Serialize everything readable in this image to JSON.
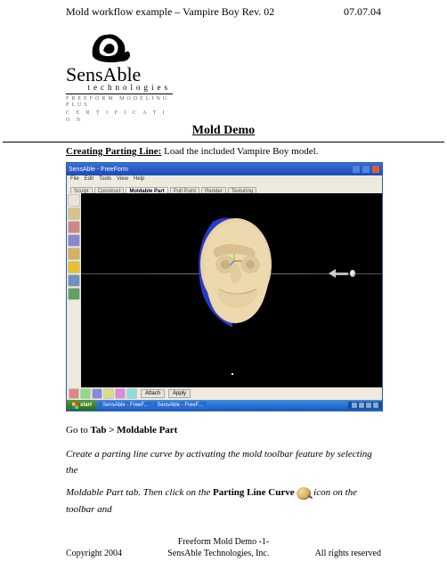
{
  "header": {
    "doc_title": "Mold workflow example – Vampire Boy Rev. 02",
    "date": "07.07.04"
  },
  "logo": {
    "name_main": "SensAble",
    "name_sub": "technologies",
    "cert_line1": "FREEFORM   MODELING   PLUS",
    "cert_line2": "C  E  R  T  I  F  I  C  A  T  I  O  N"
  },
  "title": "Mold Demo",
  "section": {
    "heading": "Creating Parting Line:",
    "heading_rest": "  Load the included Vampire Boy model."
  },
  "app_window": {
    "title": "SensAble - FreeForm",
    "menu": [
      "File",
      "Edit",
      "Tools",
      "View",
      "Help"
    ],
    "tabs": {
      "items": [
        "Sculpt",
        "Construct",
        "Moldable Part",
        "Pull Point",
        "Render",
        "Texturing"
      ],
      "active": "Moldable Part"
    },
    "side_tools": [
      {
        "name": "select-tool",
        "color": "#e8e4d8"
      },
      {
        "name": "sphere-tool",
        "color": "#d8c488"
      },
      {
        "name": "cut-tool",
        "color": "#c88"
      },
      {
        "name": "smooth-tool",
        "color": "#88c"
      },
      {
        "name": "parting-line-curve",
        "color": "#d8b060"
      },
      {
        "name": "fill-tool",
        "color": "#e8c030"
      },
      {
        "name": "draft-tool",
        "color": "#7090c0"
      },
      {
        "name": "region-tool",
        "color": "#60a060"
      }
    ],
    "bottom_tools": [
      {
        "name": "view-front",
        "color": "#d88"
      },
      {
        "name": "view-iso",
        "color": "#8d8"
      },
      {
        "name": "pan-tool",
        "color": "#88d"
      },
      {
        "name": "rotate-tool",
        "color": "#dd8"
      },
      {
        "name": "zoom-tool",
        "color": "#d8d"
      },
      {
        "name": "brush-tool",
        "color": "#8dd"
      }
    ],
    "bottom_buttons": [
      "Attach",
      "Apply"
    ]
  },
  "taskbar": {
    "start": "start",
    "items": [
      "SensAble - FreeF...",
      "SensAble - FreeF..."
    ],
    "clock": ""
  },
  "body": {
    "line1_pre": "Go to ",
    "line1_bold": "Tab > Moldable Part",
    "para_it_a": "Create a parting line curve by activating the mold toolbar feature by selecting the",
    "para_it_b": "Moldable Part tab.  Then click on the ",
    "para_bold": "Parting Line Curve",
    "para_it_c": " icon on the toolbar and"
  },
  "footer": {
    "center": "Freeform Mold Demo -1-",
    "left": "Copyright 2004",
    "mid": "SensAble Technologies, Inc.",
    "right": "All rights reserved"
  }
}
